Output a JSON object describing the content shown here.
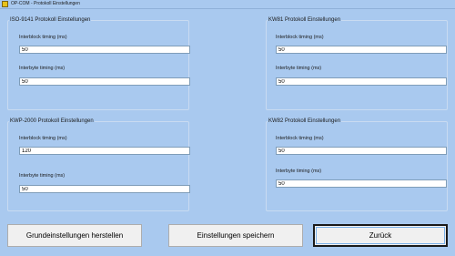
{
  "window": {
    "title": "OP-COM - Protokoll Einstellungen"
  },
  "groups": {
    "iso9141": {
      "title": "ISO-9141 Protokoll Einstellungen",
      "interblock_label": "Interblock timing (ms)",
      "interblock_value": "50",
      "interbyte_label": "Interbyte timing (ms)",
      "interbyte_value": "50"
    },
    "kw81": {
      "title": "KW81 Protokoll Einstellungen",
      "interblock_label": "Interblock timing (ms)",
      "interblock_value": "50",
      "interbyte_label": "Interbyte timing (ms)",
      "interbyte_value": "50"
    },
    "kwp2000": {
      "title": "KWP-2000 Protokoll Einstellungen",
      "interblock_label": "Interblock timing (ms)",
      "interblock_value": "120",
      "interbyte_label": "Interbyte timing (ms)",
      "interbyte_value": "50"
    },
    "kw82": {
      "title": "KW82 Protokoll Einstellungen",
      "interblock_label": "Interblock timing (ms)",
      "interblock_value": "50",
      "interbyte_label": "Interbyte timing (ms)",
      "interbyte_value": "50"
    }
  },
  "buttons": {
    "defaults_label": "Grundeinstellungen herstellen",
    "save_label": "Einstellungen speichern",
    "back_label": "Zurück"
  },
  "colors": {
    "background": "#a9c9ef",
    "app_icon": "#e8c21a"
  }
}
